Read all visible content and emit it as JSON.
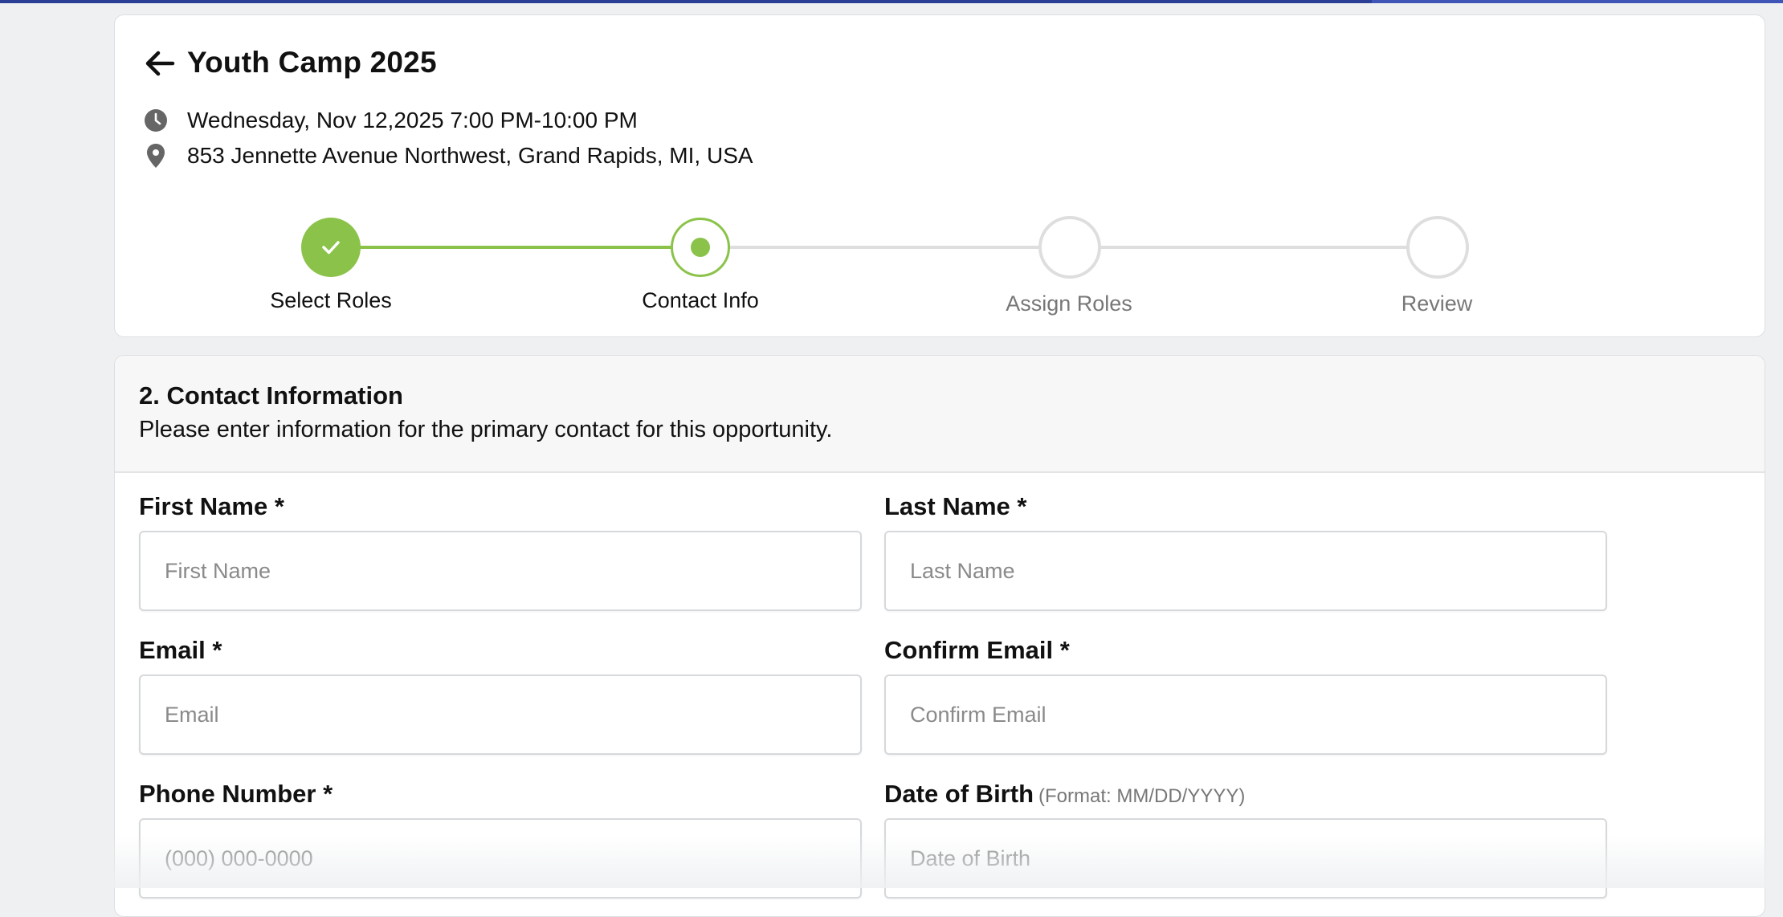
{
  "event": {
    "title": "Youth Camp 2025",
    "datetime": "Wednesday, Nov 12,2025 7:00 PM-10:00 PM",
    "location": "853 Jennette Avenue Northwest, Grand Rapids, MI, USA"
  },
  "stepper": {
    "steps": [
      {
        "label": "Select Roles",
        "state": "completed"
      },
      {
        "label": "Contact Info",
        "state": "active"
      },
      {
        "label": "Assign Roles",
        "state": "pending"
      },
      {
        "label": "Review",
        "state": "pending"
      }
    ]
  },
  "form": {
    "title": "2. Contact Information",
    "subtitle": "Please enter information for the primary contact for this opportunity.",
    "fields": {
      "first_name": {
        "label": "First Name *",
        "placeholder": "First Name",
        "value": ""
      },
      "last_name": {
        "label": "Last Name *",
        "placeholder": "Last Name",
        "value": ""
      },
      "email": {
        "label": "Email *",
        "placeholder": "Email",
        "value": ""
      },
      "confirm_email": {
        "label": "Confirm Email *",
        "placeholder": "Confirm Email",
        "value": ""
      },
      "phone": {
        "label": "Phone Number *",
        "placeholder": "(000) 000-0000",
        "value": ""
      },
      "dob": {
        "label": "Date of Birth",
        "hint": "(Format: MM/DD/YYYY)",
        "placeholder": "Date of Birth",
        "value": ""
      }
    }
  },
  "icons": {
    "back": "arrow-left-icon",
    "datetime": "clock-icon",
    "location": "map-pin-icon",
    "completed_step": "check-icon"
  },
  "colors": {
    "accent": "#8bc34a",
    "top_bar": "#2b3f96",
    "pending": "#dedede"
  }
}
